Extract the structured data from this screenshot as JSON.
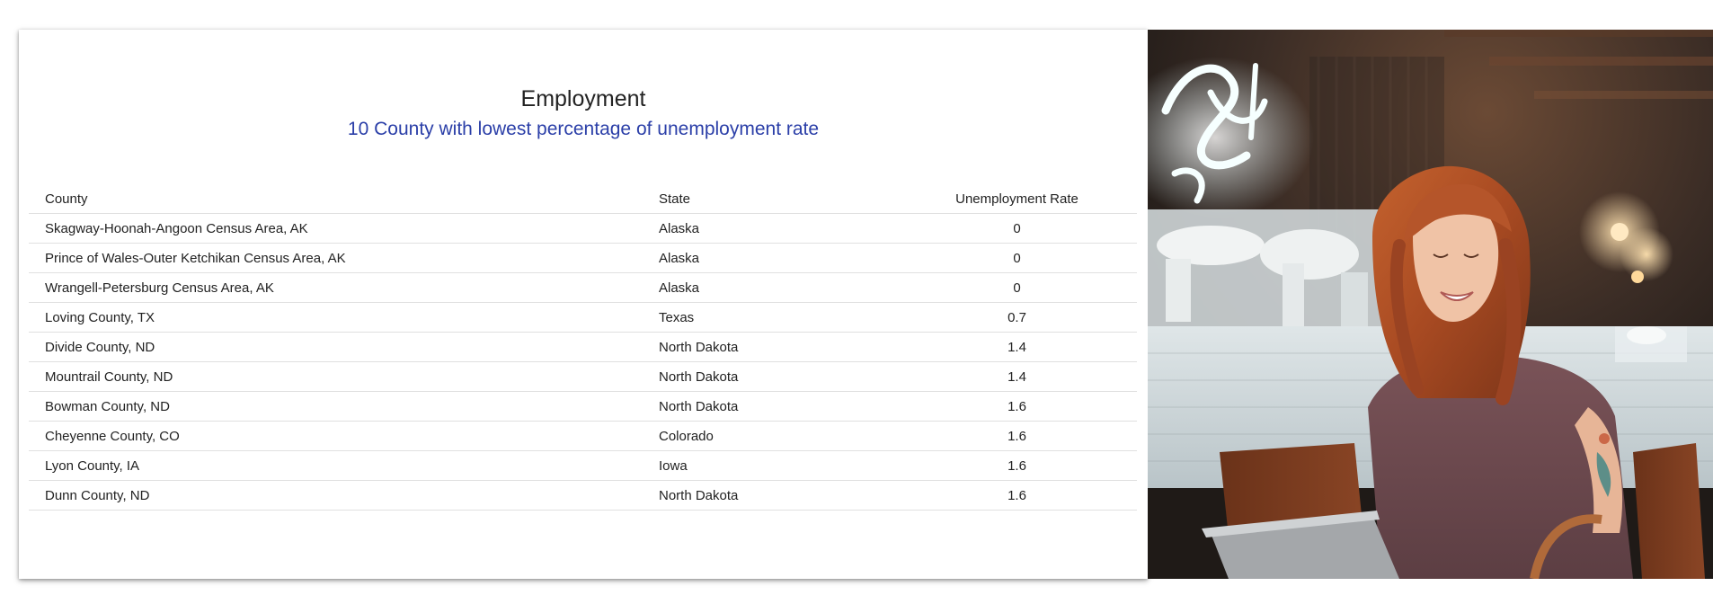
{
  "card": {
    "title": "Employment",
    "subtitle": "10 County with lowest percentage of unemployment rate",
    "subtitle_color": "#2b3fa8"
  },
  "table": {
    "headers": [
      "County",
      "State",
      "Unemployment Rate"
    ],
    "rows": [
      {
        "county": "Skagway-Hoonah-Angoon Census Area, AK",
        "state": "Alaska",
        "rate": "0"
      },
      {
        "county": "Prince of Wales-Outer Ketchikan Census Area, AK",
        "state": "Alaska",
        "rate": "0"
      },
      {
        "county": "Wrangell-Petersburg Census Area, AK",
        "state": "Alaska",
        "rate": "0"
      },
      {
        "county": "Loving County, TX",
        "state": "Texas",
        "rate": "0.7"
      },
      {
        "county": "Divide County, ND",
        "state": "North Dakota",
        "rate": "1.4"
      },
      {
        "county": "Mountrail County, ND",
        "state": "North Dakota",
        "rate": "1.4"
      },
      {
        "county": "Bowman County, ND",
        "state": "North Dakota",
        "rate": "1.6"
      },
      {
        "county": "Cheyenne County, CO",
        "state": "Colorado",
        "rate": "1.6"
      },
      {
        "county": "Lyon County, IA",
        "state": "Iowa",
        "rate": "1.6"
      },
      {
        "county": "Dunn County, ND",
        "state": "North Dakota",
        "rate": "1.6"
      }
    ]
  },
  "photo": {
    "subject": "woman-using-laptop-in-cafe"
  }
}
